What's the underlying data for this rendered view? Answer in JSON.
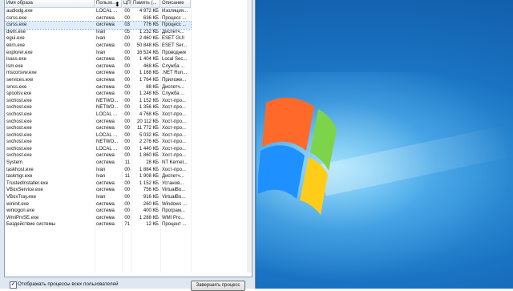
{
  "columns": [
    "Имя образа",
    "Пользо...",
    "ЦП",
    "Память (...",
    "Описание"
  ],
  "rows": [
    {
      "name": "audiodg.exe",
      "user": "LOCAL ...",
      "cpu": "00",
      "mem": "4 972 КБ",
      "desc": "Изоляция..."
    },
    {
      "name": "csrss.exe",
      "user": "система",
      "cpu": "00",
      "mem": "636 КБ",
      "desc": "Процесс ..."
    },
    {
      "name": "csrss.exe",
      "user": "система",
      "cpu": "03",
      "mem": "776 КБ",
      "desc": "Процесс ...",
      "selected": true
    },
    {
      "name": "dwm.exe",
      "user": "Ivan",
      "cpu": "05",
      "mem": "1 232 КБ",
      "desc": "Диспетч..."
    },
    {
      "name": "egui.exe",
      "user": "Ivan",
      "cpu": "00",
      "mem": "2 460 КБ",
      "desc": "ESET GUI"
    },
    {
      "name": "ekrn.exe",
      "user": "система",
      "cpu": "00",
      "mem": "50 848 КБ",
      "desc": "ESET Ser..."
    },
    {
      "name": "explorer.exe",
      "user": "Ivan",
      "cpu": "00",
      "mem": "16 524 КБ",
      "desc": "Проводник"
    },
    {
      "name": "lsass.exe",
      "user": "система",
      "cpu": "00",
      "mem": "1 404 КБ",
      "desc": "Local Sec..."
    },
    {
      "name": "lsm.exe",
      "user": "система",
      "cpu": "00",
      "mem": "468 КБ",
      "desc": "Служба ..."
    },
    {
      "name": "mscorsvw.exe",
      "user": "система",
      "cpu": "00",
      "mem": "1 168 КБ",
      ".desc": "",
      "desc": ".NET Run..."
    },
    {
      "name": "services.exe",
      "user": "система",
      "cpu": "00",
      "mem": "1 764 КБ",
      "desc": "Приложе..."
    },
    {
      "name": "smss.exe",
      "user": "система",
      "cpu": "00",
      "mem": "88 КБ",
      "desc": "Диспетч..."
    },
    {
      "name": "spoolsv.exe",
      "user": "система",
      "cpu": "00",
      "mem": "1 248 КБ",
      "desc": "Служба ..."
    },
    {
      "name": "svchost.exe",
      "user": "NETWO...",
      "cpu": "00",
      "mem": "1 152 КБ",
      "desc": "Хост-про..."
    },
    {
      "name": "svchost.exe",
      "user": "NETWO...",
      "cpu": "00",
      "mem": "1 356 КБ",
      "desc": "Хост-про..."
    },
    {
      "name": "svchost.exe",
      "user": "LOCAL ...",
      "cpu": "00",
      "mem": "4 768 КБ",
      "desc": "Хост-про..."
    },
    {
      "name": "svchost.exe",
      "user": "система",
      "cpu": "00",
      "mem": "20 112 КБ",
      "desc": "Хост-про..."
    },
    {
      "name": "svchost.exe",
      "user": "система",
      "cpu": "00",
      "mem": "11 772 КБ",
      "desc": "Хост-про..."
    },
    {
      "name": "svchost.exe",
      "user": "LOCAL ...",
      "cpu": "00",
      "mem": "5 032 КБ",
      "desc": "Хост-про..."
    },
    {
      "name": "svchost.exe",
      "user": "NETWO...",
      "cpu": "00",
      "mem": "2 276 КБ",
      "desc": "Хост-про..."
    },
    {
      "name": "svchost.exe",
      "user": "LOCAL ...",
      "cpu": "00",
      "mem": "1 440 КБ",
      "desc": "Хост-про..."
    },
    {
      "name": "svchost.exe",
      "user": "система",
      "cpu": "00",
      "mem": "1 860 КБ",
      "desc": "Хост-про..."
    },
    {
      "name": "System",
      "user": "система",
      "cpu": "11",
      "mem": "28 КБ",
      "desc": "NT Kernel..."
    },
    {
      "name": "taskhost.exe",
      "user": "Ivan",
      "cpu": "00",
      "mem": "1 884 КБ",
      "desc": "Хост-про..."
    },
    {
      "name": "taskmgr.exe",
      "user": "Ivan",
      "cpu": "11",
      "mem": "1 908 КБ",
      "desc": "Диспетч..."
    },
    {
      "name": "TrustedInstaller.exe",
      "user": "система",
      "cpu": "00",
      "mem": "1 152 КБ",
      "desc": "Установ..."
    },
    {
      "name": "VBoxService.exe",
      "user": "система",
      "cpu": "00",
      "mem": "756 КБ",
      "desc": "VirtualBo..."
    },
    {
      "name": "VBoxTray.exe",
      "user": "Ivan",
      "cpu": "00",
      "mem": "916 КБ",
      "desc": "VirtualBo..."
    },
    {
      "name": "wininit.exe",
      "user": "система",
      "cpu": "00",
      "mem": "260 КБ",
      "desc": "Windows ..."
    },
    {
      "name": "winlogon.exe",
      "user": "система",
      "cpu": "00",
      "mem": "400 КБ",
      "desc": "Програм..."
    },
    {
      "name": "WmiPrvSE.exe",
      "user": "система",
      "cpu": "00",
      "mem": "1 288 КБ",
      "desc": "WMI Pro..."
    },
    {
      "name": "Бездействие системы",
      "user": "система",
      "cpu": "71",
      "mem": "12 КБ",
      "desc": "Процент ..."
    }
  ],
  "footer": {
    "show_all_label": "Отображать процессы всех пользователей",
    "show_all_checked": "✔",
    "end_process_label": "Завершить процесс"
  },
  "colors": {
    "selected_row": "#dfeefe",
    "desktop": "#1a73c2"
  }
}
